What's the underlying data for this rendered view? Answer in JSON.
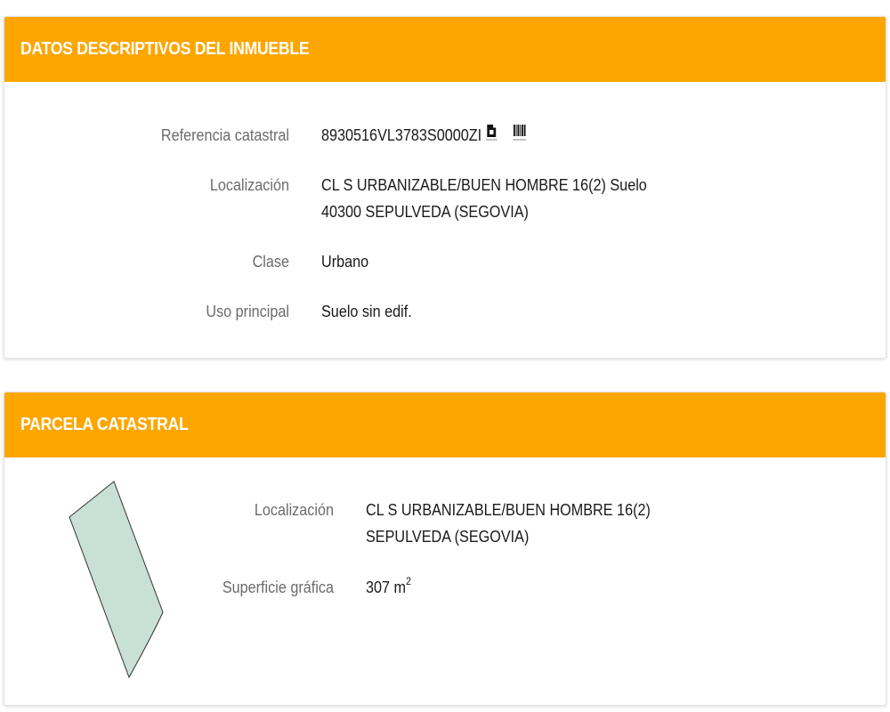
{
  "card1": {
    "title": "DATOS DESCRIPTIVOS DEL INMUEBLE",
    "rows": [
      {
        "label": "Referencia catastral",
        "value": "8930516VL3783S0000ZI"
      },
      {
        "label": "Localización",
        "value_line1": "CL S URBANIZABLE/BUEN HOMBRE 16(2) Suelo",
        "value_line2": "40300 SEPULVEDA (SEGOVIA)"
      },
      {
        "label": "Clase",
        "value": "Urbano"
      },
      {
        "label": "Uso principal",
        "value": "Suelo sin edif."
      }
    ],
    "icons": {
      "copy": "copy-document-icon",
      "barcode": "barcode-icon"
    }
  },
  "card2": {
    "title": "PARCELA CATASTRAL",
    "rows": [
      {
        "label": "Localización",
        "value_line1": "CL S URBANIZABLE/BUEN HOMBRE 16(2)",
        "value_line2": "SEPULVEDA (SEGOVIA)"
      },
      {
        "label": "Superficie gráfica",
        "value": "307 m",
        "unit_sup": "2"
      }
    ],
    "parcel_icon": "parcel-shape-icon"
  },
  "colors": {
    "header_bg": "#fda601",
    "header_text": "#ffffff",
    "label_text": "#6b6b6b",
    "value_text": "#1a1a1a",
    "parcel_fill": "#c8e0d6",
    "parcel_stroke": "#333333"
  }
}
